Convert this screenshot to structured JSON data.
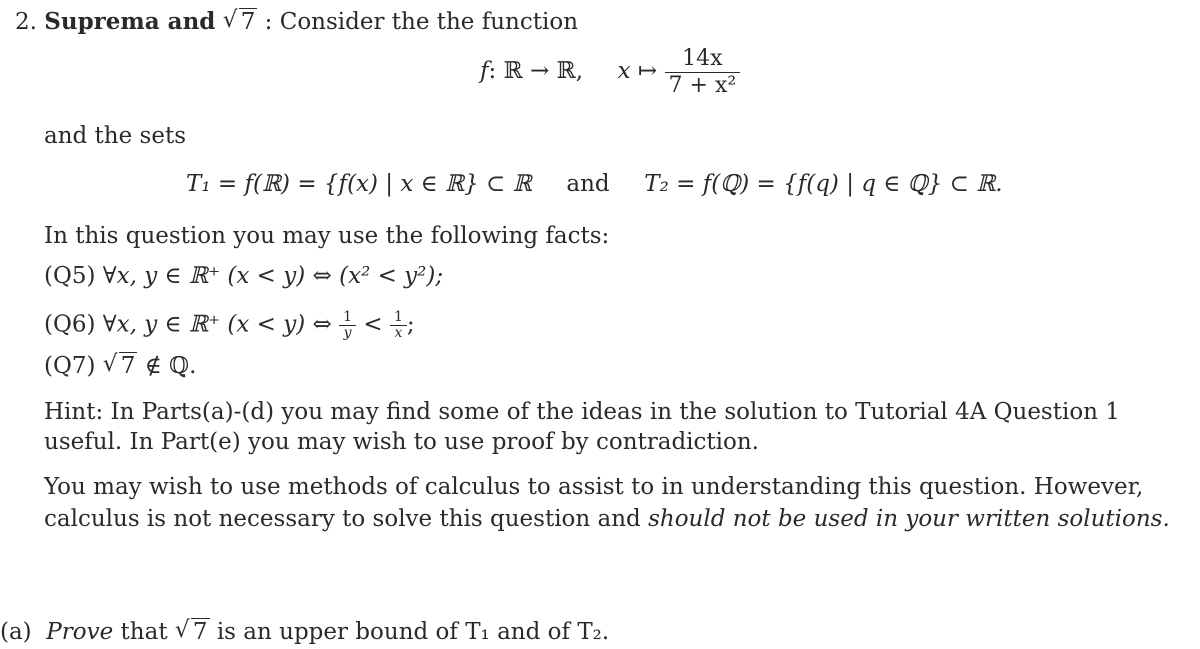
{
  "heading": {
    "number": "2.",
    "title": "Suprema and",
    "sqrt_value": "7",
    "colon": ":",
    "intro": "Consider the the function"
  },
  "function_def": {
    "name": "f",
    "domain_map": ": ℝ → ℝ,",
    "var": "x",
    "mapsto": "↦",
    "numerator": "14x",
    "denominator": "7 + x²"
  },
  "sets_intro": "and the sets",
  "sets": {
    "t1": "T₁ = f(ℝ) = {f(x) | x ∈ ℝ} ⊂ ℝ",
    "connector": "and",
    "t2": "T₂ = f(ℚ) = {f(q) | q ∈ ℚ} ⊂ ℝ."
  },
  "facts_intro": "In this question you may use the following facts:",
  "facts": [
    {
      "label": "(Q5)",
      "text": "∀x, y ∈ ℝ⁺  (x < y) ⇔ (x² < y²);"
    },
    {
      "label": "(Q6)",
      "text_before": "∀x, y ∈ ℝ⁺  (x < y) ⇔",
      "frac1_num": "1",
      "frac1_den": "y",
      "lt": "<",
      "frac2_num": "1",
      "frac2_den": "x",
      "end": ";"
    },
    {
      "label": "(Q7)",
      "sqrt_value": "7",
      "text": "∉ ℚ."
    }
  ],
  "hint": {
    "label": "Hint:",
    "line1": "In Parts(a)-(d) you may find some of the ideas in the solution to Tutorial 4A Question 1",
    "line2": "useful. In Part(e) you may wish to use proof by contradiction."
  },
  "calculus_note": {
    "line1": "You may wish to use methods of calculus to assist to in understanding this question.  However,",
    "line2_plain": "calculus is not necessary to solve this question and",
    "line2_italic": "should not be used in your written solutions."
  },
  "part_a": {
    "label": "(a)",
    "verb": "Prove",
    "text1": "that",
    "sqrt_value": "7",
    "text2": "is an upper bound of T₁ and of T₂."
  }
}
